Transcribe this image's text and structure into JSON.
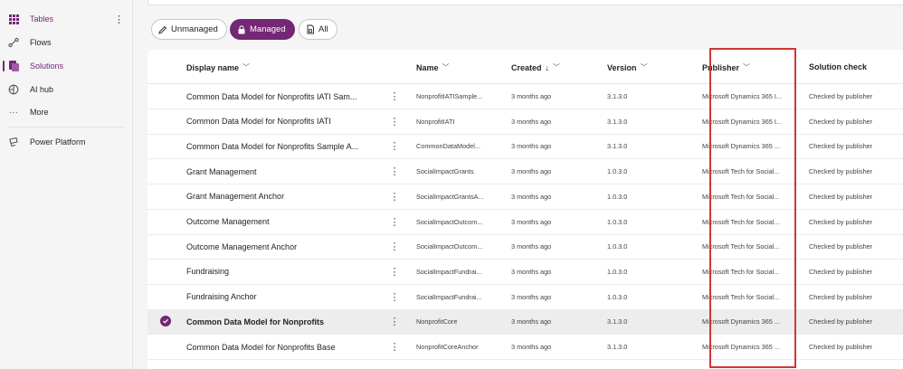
{
  "sidebar": {
    "items": [
      {
        "label": "Tables",
        "icon": "grid-icon"
      },
      {
        "label": "Flows",
        "icon": "flow-icon"
      },
      {
        "label": "Solutions",
        "icon": "solutions-icon"
      },
      {
        "label": "AI hub",
        "icon": "ai-hub-icon"
      },
      {
        "label": "More",
        "icon": "ellipsis-icon"
      },
      {
        "label": "Power Platform",
        "icon": "power-platform-icon"
      }
    ],
    "kebab": "⋮"
  },
  "filters": {
    "unmanaged": "Unmanaged",
    "managed": "Managed",
    "all": "All"
  },
  "columns": {
    "display_name": "Display name",
    "name": "Name",
    "created": "Created",
    "created_sort": "↓",
    "version": "Version",
    "publisher": "Publisher",
    "solution_check": "Solution check"
  },
  "rows": [
    {
      "display": "Common Data Model for Nonprofits IATI Sam...",
      "name": "NonprofitIATISample...",
      "created": "3 months ago",
      "version": "3.1.3.0",
      "publisher": "Microsoft Dynamics 365 I...",
      "check": "Checked by publisher",
      "selected": false
    },
    {
      "display": "Common Data Model for Nonprofits IATI",
      "name": "NonprofitIATI",
      "created": "3 months ago",
      "version": "3.1.3.0",
      "publisher": "Microsoft Dynamics 365 I...",
      "check": "Checked by publisher",
      "selected": false
    },
    {
      "display": "Common Data Model for Nonprofits Sample A...",
      "name": "CommonDataModel...",
      "created": "3 months ago",
      "version": "3.1.3.0",
      "publisher": "Microsoft Dynamics 365 ...",
      "check": "Checked by publisher",
      "selected": false
    },
    {
      "display": "Grant Management",
      "name": "SocialImpactGrants",
      "created": "3 months ago",
      "version": "1.0.3.0",
      "publisher": "Microsoft Tech for Social...",
      "check": "Checked by publisher",
      "selected": false
    },
    {
      "display": "Grant Management Anchor",
      "name": "SocialImpactGrantsA...",
      "created": "3 months ago",
      "version": "1.0.3.0",
      "publisher": "Microsoft Tech for Social...",
      "check": "Checked by publisher",
      "selected": false
    },
    {
      "display": "Outcome Management",
      "name": "SocialImpactOutcom...",
      "created": "3 months ago",
      "version": "1.0.3.0",
      "publisher": "Microsoft Tech for Social...",
      "check": "Checked by publisher",
      "selected": false
    },
    {
      "display": "Outcome Management Anchor",
      "name": "SocialImpactOutcom...",
      "created": "3 months ago",
      "version": "1.0.3.0",
      "publisher": "Microsoft Tech for Social...",
      "check": "Checked by publisher",
      "selected": false
    },
    {
      "display": "Fundraising",
      "name": "SocialImpactFundrai...",
      "created": "3 months ago",
      "version": "1.0.3.0",
      "publisher": "Microsoft Tech for Social...",
      "check": "Checked by publisher",
      "selected": false
    },
    {
      "display": "Fundraising Anchor",
      "name": "SocialImpactFundrai...",
      "created": "3 months ago",
      "version": "1.0.3.0",
      "publisher": "Microsoft Tech for Social...",
      "check": "Checked by publisher",
      "selected": false
    },
    {
      "display": "Common Data Model for Nonprofits",
      "name": "NonprofitCore",
      "created": "3 months ago",
      "version": "3.1.3.0",
      "publisher": "Microsoft Dynamics 365 ...",
      "check": "Checked by publisher",
      "selected": true
    },
    {
      "display": "Common Data Model for Nonprofits Base",
      "name": "NonprofitCoreAnchor",
      "created": "3 months ago",
      "version": "3.1.3.0",
      "publisher": "Microsoft Dynamics 365 ...",
      "check": "Checked by publisher",
      "selected": false
    }
  ],
  "row_more": "⋮",
  "colors": {
    "accent": "#742774",
    "highlight": "#d13438"
  }
}
